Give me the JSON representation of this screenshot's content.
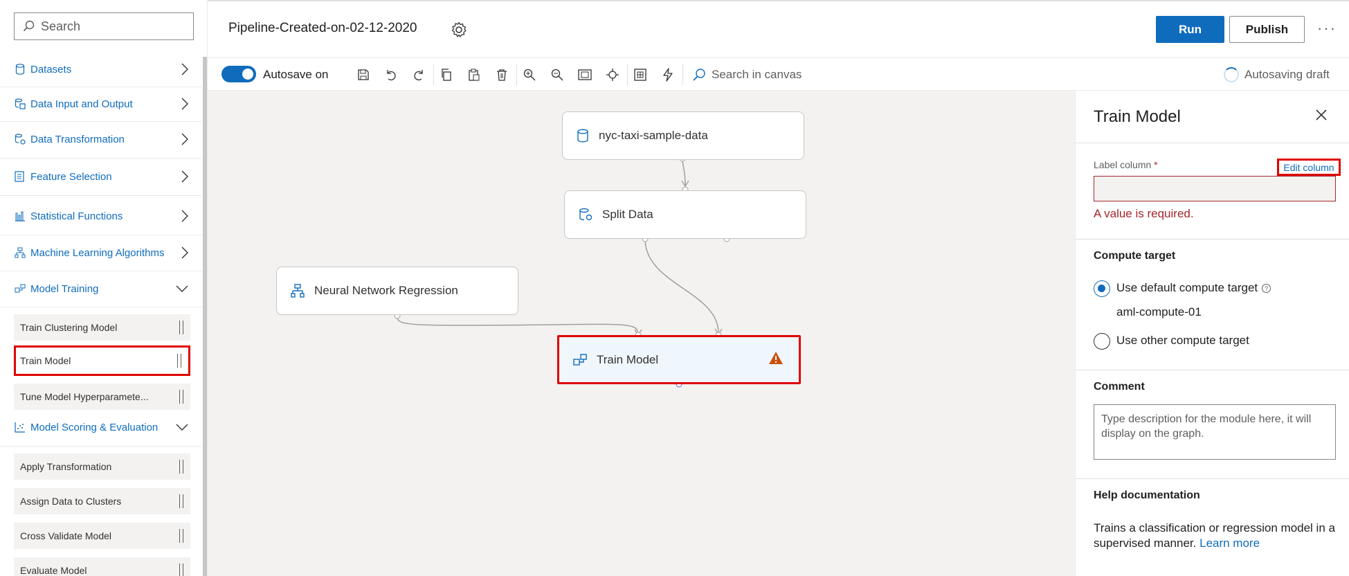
{
  "sidebar": {
    "search_placeholder": "Search",
    "categories": [
      {
        "label": "Datasets"
      },
      {
        "label": "Data Input and Output"
      },
      {
        "label": "Data Transformation"
      },
      {
        "label": "Feature Selection"
      },
      {
        "label": "Statistical Functions"
      },
      {
        "label": "Machine Learning Algorithms"
      },
      {
        "label": "Model Training"
      },
      {
        "label": "Model Scoring & Evaluation"
      }
    ],
    "training_modules": [
      "Train Clustering Model",
      "Train Model",
      "Tune Model Hyperparamete..."
    ],
    "scoring_modules": [
      "Apply Transformation",
      "Assign Data to Clusters",
      "Cross Validate Model",
      "Evaluate Model"
    ]
  },
  "header": {
    "title": "Pipeline-Created-on-02-12-2020",
    "run_label": "Run",
    "publish_label": "Publish",
    "more_label": "···"
  },
  "toolbar": {
    "autosave_label": "Autosave on",
    "canvas_search_placeholder": "Search in canvas",
    "autosave_status": "Autosaving draft"
  },
  "canvas": {
    "nodes": {
      "dataset": "nyc-taxi-sample-data",
      "split": "Split Data",
      "nn": "Neural Network Regression",
      "train": "Train Model"
    }
  },
  "panel": {
    "title": "Train Model",
    "label_column": "Label column",
    "required_mark": "*",
    "edit_column": "Edit column",
    "error": "A value is required.",
    "compute_heading": "Compute target",
    "default_target": "Use default compute target",
    "compute_name": "aml-compute-01",
    "other_target": "Use other compute target",
    "comment_heading": "Comment",
    "comment_placeholder": "Type description for the module here, it will display on the graph.",
    "help_heading": "Help documentation",
    "help_text": "Trains a classification or regression model in a supervised manner.",
    "learn_more": "Learn more"
  },
  "colors": {
    "accent": "#0f6cbd",
    "highlight": "#e00000",
    "error": "#a4262c",
    "warning": "#ca5010"
  }
}
